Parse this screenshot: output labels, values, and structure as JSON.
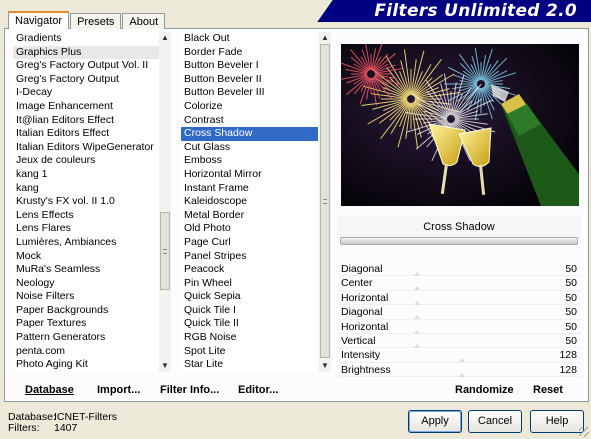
{
  "tabs": [
    {
      "label": "Navigator",
      "active": true
    },
    {
      "label": "Presets",
      "active": false
    },
    {
      "label": "About",
      "active": false
    }
  ],
  "title": "Filters Unlimited 2.0",
  "categories": [
    "Gradients",
    "Graphics Plus",
    "Greg's Factory Output Vol. II",
    "Greg's Factory Output",
    "I-Decay",
    "Image Enhancement",
    "It@lian Editors Effect",
    "Italian Editors Effect",
    "Italian Editors WipeGenerator",
    "Jeux de couleurs",
    "kang 1",
    "kang",
    "Krusty's FX vol. II 1.0",
    "Lens Effects",
    "Lens Flares",
    "Lumières, Ambiances",
    "Mock",
    "MuRa's Seamless",
    "Neology",
    "Noise Filters",
    "Paper Backgrounds",
    "Paper Textures",
    "Pattern Generators",
    "penta.com",
    "Photo Aging Kit"
  ],
  "categories_selected": "Graphics Plus",
  "filters": [
    "Black Out",
    "Border Fade",
    "Button Beveler I",
    "Button Beveler II",
    "Button Beveler III",
    "Colorize",
    "Contrast",
    "Cross Shadow",
    "Cut Glass",
    "Emboss",
    "Horizontal Mirror",
    "Instant Frame",
    "Kaleidoscope",
    "Metal Border",
    "Old Photo",
    "Page Curl",
    "Panel Stripes",
    "Peacock",
    "Pin Wheel",
    "Quick Sepia",
    "Quick Tile I",
    "Quick Tile II",
    "RGB Noise",
    "Spot Lite",
    "Star Lite"
  ],
  "filters_selected": "Cross Shadow",
  "selected_filter_name": "Cross Shadow",
  "params": [
    {
      "name": "Diagonal",
      "value": "50",
      "level": 0.2
    },
    {
      "name": "Center",
      "value": "50",
      "level": 0.2
    },
    {
      "name": "Horizontal",
      "value": "50",
      "level": 0.2
    },
    {
      "name": "Diagonal",
      "value": "50",
      "level": 0.2
    },
    {
      "name": "Horizontal",
      "value": "50",
      "level": 0.2
    },
    {
      "name": "Vertical",
      "value": "50",
      "level": 0.2
    },
    {
      "name": "Intensity",
      "value": "128",
      "level": 0.5
    },
    {
      "name": "Brightness",
      "value": "128",
      "level": 0.5
    }
  ],
  "links": {
    "database": "Database",
    "import": "Import...",
    "filter_info": "Filter Info...",
    "editor": "Editor...",
    "randomize": "Randomize",
    "reset": "Reset"
  },
  "status": {
    "database_label": "Database:",
    "database_value": "ICNET-Filters",
    "filters_label": "Filters:",
    "filters_value": "1407"
  },
  "buttons": {
    "apply": "Apply",
    "cancel": "Cancel",
    "help": "Help"
  },
  "colors": {
    "title_bar": "#000080",
    "selection": "#3169c6",
    "dialog_bg": "#ece9d8"
  }
}
